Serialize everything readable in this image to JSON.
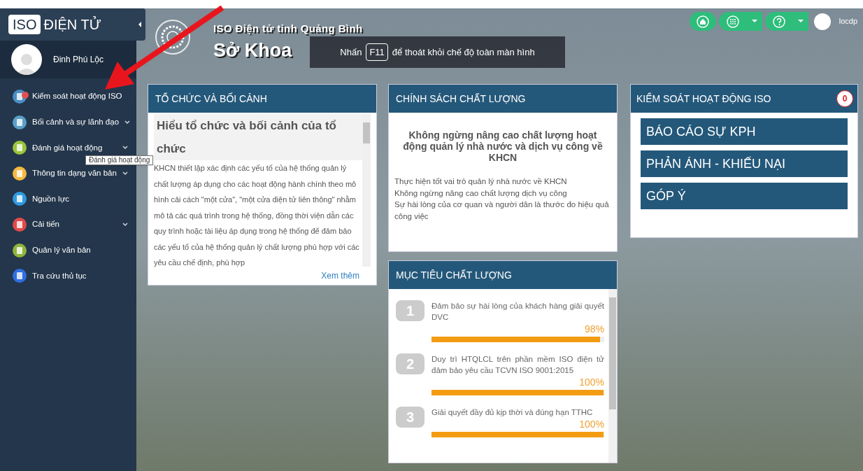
{
  "sidebar": {
    "logo_badge": "ISO",
    "logo_text": "ĐIỆN TỬ",
    "user_name": "Đinh Phú Lộc",
    "items": [
      {
        "label": "Kiểm soát hoạt động ISO",
        "kind": "link",
        "color": "#4a8fc4",
        "alert": true
      },
      {
        "label": "Bối cảnh và sự lãnh đạo",
        "kind": "submenu",
        "color": "#5aa0c8",
        "alert": false
      },
      {
        "label": "Đánh giá hoạt động",
        "kind": "submenu",
        "color": "#9cc43c",
        "alert": false
      },
      {
        "label": "Thông tin dạng văn bản",
        "kind": "submenu",
        "color": "#f5b942",
        "alert": false
      },
      {
        "label": "Nguồn lực",
        "kind": "link",
        "color": "#2f9be0",
        "alert": false
      },
      {
        "label": "Cải tiến",
        "kind": "submenu",
        "color": "#e04a4a",
        "alert": false
      },
      {
        "label": "Quản lý văn bản",
        "kind": "link",
        "color": "#8fb43a",
        "alert": false
      },
      {
        "label": "Tra cứu thủ tục",
        "kind": "link",
        "color": "#2f6fe0",
        "alert": false
      }
    ],
    "tooltip": "Đánh giá hoạt động"
  },
  "header": {
    "subtitle": "ISO Điện tử tỉnh Quảng Bình",
    "title": "Sở Khoa",
    "notice": {
      "before": "Nhấn",
      "key": "F11",
      "after": "để thoát khỏi chế độ toàn màn hình"
    }
  },
  "topbar": {
    "user": "locdp"
  },
  "organization": {
    "title": "TỔ CHỨC VÀ BỐI CẢNH",
    "heading": "Hiểu tổ chức và bối cảnh của tổ chức",
    "body": "KHCN thiết lập xác định các yếu tố của hệ thống quản lý chất lượng áp dụng cho các hoạt động hành chính theo mô hình cải cách \"một cửa\", \"một cửa điện tử liên thông\" nhằm mô tả các quá trình trong hệ thống, đồng thời viện dẫn các quy trình hoặc tài liệu áp dụng trong hệ thống để đảm bảo các yếu tố của hệ thống quản lý chất lượng phù hợp với các yêu cầu chế định, phù hợp",
    "more": "Xem thêm"
  },
  "policy": {
    "title": "CHÍNH SÁCH CHẤT LƯỢNG",
    "slogan": "Không ngừng nâng cao chất lượng hoạt động quản lý nhà nước và dịch vụ công về KHCN",
    "lines": [
      "Thực hiện tốt vai trò quản lý nhà nước về KHCN",
      "Không ngừng nâng cao chất lượng dịch vụ công",
      "Sự hài lòng của cơ quan và người dân là thước đo hiệu quả công việc"
    ]
  },
  "objectives": {
    "title": "MỤC TIÊU CHẤT LƯỢNG",
    "items": [
      {
        "number": "1",
        "text": "Đảm bảo sự hài lòng của khách hàng giải quyết DVC",
        "percent": "98%",
        "level": 0.98
      },
      {
        "number": "2",
        "text": "Duy trì HTQLCL trên phần mềm ISO điện tử đảm bảo yêu cầu TCVN ISO 9001:2015",
        "percent": "100%",
        "level": 1
      },
      {
        "number": "3",
        "text": "Giải quyết đầy đủ kịp thời và đúng hạn TTHC",
        "percent": "100%",
        "level": 1
      }
    ]
  },
  "control": {
    "title": "KIỂM SOÁT HOẠT ĐỘNG ISO",
    "count": "0",
    "buttons": [
      "BÁO CÁO SỰ KPH",
      "PHẢN ÁNH - KHIẾU NẠI",
      "GÓP Ý"
    ]
  }
}
